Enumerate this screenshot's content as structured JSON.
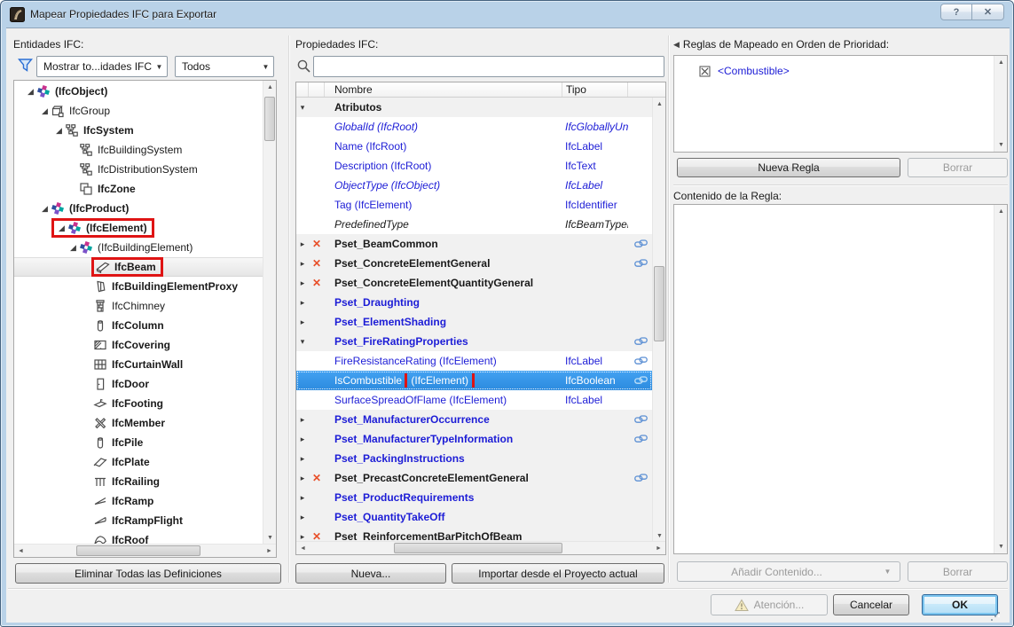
{
  "window": {
    "title": "Mapear Propiedades IFC para Exportar",
    "help": "?",
    "close": "✕"
  },
  "icons": {
    "titlebar": "archicad-logo-icon",
    "filter": "funnel-icon",
    "search": "magnifier-icon",
    "warning": "warning-triangle-icon",
    "rule_item": "checkbox-x-icon",
    "mapped": "chain-link-icon",
    "unmapped": "red-x-icon"
  },
  "entities": {
    "label": "Entidades IFC:",
    "filter_dropdown": "Mostrar to...idades IFC",
    "type_dropdown": "Todos",
    "delete_all_button": "Eliminar Todas las Definiciones",
    "tree": [
      {
        "label": "(IfcObject)",
        "level": 1,
        "bold": true,
        "expanded": true,
        "icon": "ifc-object"
      },
      {
        "label": "IfcGroup",
        "level": 2,
        "bold": false,
        "expanded": true,
        "icon": "group"
      },
      {
        "label": "IfcSystem",
        "level": 3,
        "bold": true,
        "expanded": true,
        "icon": "system"
      },
      {
        "label": "IfcBuildingSystem",
        "level": 4,
        "bold": false,
        "expanded": false,
        "icon": "system"
      },
      {
        "label": "IfcDistributionSystem",
        "level": 4,
        "bold": false,
        "expanded": false,
        "icon": "system"
      },
      {
        "label": "IfcZone",
        "level": 4,
        "bold": true,
        "expanded": false,
        "icon": "zone"
      },
      {
        "label": "(IfcProduct)",
        "level": 2,
        "bold": true,
        "expanded": true,
        "icon": "ifc-object"
      },
      {
        "label": "(IfcElement)",
        "level": 3,
        "bold": true,
        "expanded": true,
        "icon": "ifc-object",
        "red_box": true
      },
      {
        "label": "(IfcBuildingElement)",
        "level": 4,
        "bold": false,
        "expanded": true,
        "icon": "ifc-object"
      },
      {
        "label": "IfcBeam",
        "level": 5,
        "bold": true,
        "expanded": false,
        "icon": "beam",
        "selected": true,
        "red_box": true
      },
      {
        "label": "IfcBuildingElementProxy",
        "level": 5,
        "bold": true,
        "expanded": false,
        "icon": "proxy"
      },
      {
        "label": "IfcChimney",
        "level": 5,
        "bold": false,
        "expanded": false,
        "icon": "chimney"
      },
      {
        "label": "IfcColumn",
        "level": 5,
        "bold": true,
        "expanded": false,
        "icon": "column"
      },
      {
        "label": "IfcCovering",
        "level": 5,
        "bold": true,
        "expanded": false,
        "icon": "covering"
      },
      {
        "label": "IfcCurtainWall",
        "level": 5,
        "bold": true,
        "expanded": false,
        "icon": "curtainwall"
      },
      {
        "label": "IfcDoor",
        "level": 5,
        "bold": true,
        "expanded": false,
        "icon": "door"
      },
      {
        "label": "IfcFooting",
        "level": 5,
        "bold": true,
        "expanded": false,
        "icon": "footing"
      },
      {
        "label": "IfcMember",
        "level": 5,
        "bold": true,
        "expanded": false,
        "icon": "member"
      },
      {
        "label": "IfcPile",
        "level": 5,
        "bold": true,
        "expanded": false,
        "icon": "pile"
      },
      {
        "label": "IfcPlate",
        "level": 5,
        "bold": true,
        "expanded": false,
        "icon": "plate"
      },
      {
        "label": "IfcRailing",
        "level": 5,
        "bold": true,
        "expanded": false,
        "icon": "railing"
      },
      {
        "label": "IfcRamp",
        "level": 5,
        "bold": true,
        "expanded": false,
        "icon": "ramp"
      },
      {
        "label": "IfcRampFlight",
        "level": 5,
        "bold": true,
        "expanded": false,
        "icon": "rampflight"
      },
      {
        "label": "IfcRoof",
        "level": 5,
        "bold": true,
        "expanded": false,
        "icon": "roof"
      }
    ]
  },
  "properties": {
    "label": "Propiedades IFC:",
    "search_value": "",
    "columns": [
      "Nombre",
      "Tipo"
    ],
    "rows": [
      {
        "kind": "group",
        "name": "Atributos",
        "expanded": true,
        "style": "black"
      },
      {
        "kind": "prop",
        "name": "GlobalId (IfcRoot)",
        "type": "IfcGloballyUni...",
        "style": "italic-blue"
      },
      {
        "kind": "prop",
        "name": "Name (IfcRoot)",
        "type": "IfcLabel",
        "style": "blue"
      },
      {
        "kind": "prop",
        "name": "Description (IfcRoot)",
        "type": "IfcText",
        "style": "blue"
      },
      {
        "kind": "prop",
        "name": "ObjectType (IfcObject)",
        "type": "IfcLabel",
        "style": "italic-blue"
      },
      {
        "kind": "prop",
        "name": "Tag (IfcElement)",
        "type": "IfcIdentifier",
        "style": "blue"
      },
      {
        "kind": "prop",
        "name": "PredefinedType",
        "type": "IfcBeamTypeEn...",
        "style": "italic-black"
      },
      {
        "kind": "pset",
        "name": "Pset_BeamCommon",
        "style": "black",
        "x": true,
        "chain": true
      },
      {
        "kind": "pset",
        "name": "Pset_ConcreteElementGeneral",
        "style": "black",
        "x": true,
        "chain": true
      },
      {
        "kind": "pset",
        "name": "Pset_ConcreteElementQuantityGeneral",
        "style": "black",
        "x": true
      },
      {
        "kind": "pset",
        "name": "Pset_Draughting",
        "style": "blue"
      },
      {
        "kind": "pset",
        "name": "Pset_ElementShading",
        "style": "blue"
      },
      {
        "kind": "pset",
        "name": "Pset_FireRatingProperties",
        "style": "blue",
        "expanded": true,
        "chain": true
      },
      {
        "kind": "prop",
        "name": "FireResistanceRating (IfcElement)",
        "type": "IfcLabel",
        "style": "blue",
        "chain": true
      },
      {
        "kind": "prop",
        "name": "IsCombustible",
        "suffix": "(IfcElement)",
        "type": "IfcBoolean",
        "style": "blue",
        "selected": true,
        "chain": true,
        "red_box": true
      },
      {
        "kind": "prop",
        "name": "SurfaceSpreadOfFlame (IfcElement)",
        "type": "IfcLabel",
        "style": "blue"
      },
      {
        "kind": "pset",
        "name": "Pset_ManufacturerOccurrence",
        "style": "blue",
        "chain": true
      },
      {
        "kind": "pset",
        "name": "Pset_ManufacturerTypeInformation",
        "style": "blue",
        "chain": true
      },
      {
        "kind": "pset",
        "name": "Pset_PackingInstructions",
        "style": "blue"
      },
      {
        "kind": "pset",
        "name": "Pset_PrecastConcreteElementGeneral",
        "style": "black",
        "x": true,
        "chain": true
      },
      {
        "kind": "pset",
        "name": "Pset_ProductRequirements",
        "style": "blue"
      },
      {
        "kind": "pset",
        "name": "Pset_QuantityTakeOff",
        "style": "blue"
      },
      {
        "kind": "pset",
        "name": "Pset_ReinforcementBarPitchOfBeam",
        "style": "black",
        "x": true
      }
    ],
    "new_button": "Nueva...",
    "import_button": "Importar desde el Proyecto actual"
  },
  "rules": {
    "label": "Reglas de Mapeado en Orden de Prioridad:",
    "items": [
      {
        "label": "<Combustible>"
      }
    ],
    "new_rule_button": "Nueva Regla",
    "delete_button": "Borrar",
    "content_label": "Contenido de la Regla:",
    "add_content_button": "Añadir Contenido...",
    "content_delete_button": "Borrar"
  },
  "footer": {
    "attention": "Atención...",
    "cancel": "Cancelar",
    "ok": "OK"
  },
  "colors": {
    "link_blue": "#1c1cd6",
    "selection_blue": "#3094e8",
    "annotation_red": "#df1414",
    "x_mark": "#e8502a",
    "chain_blue": "#5b8fd4"
  }
}
